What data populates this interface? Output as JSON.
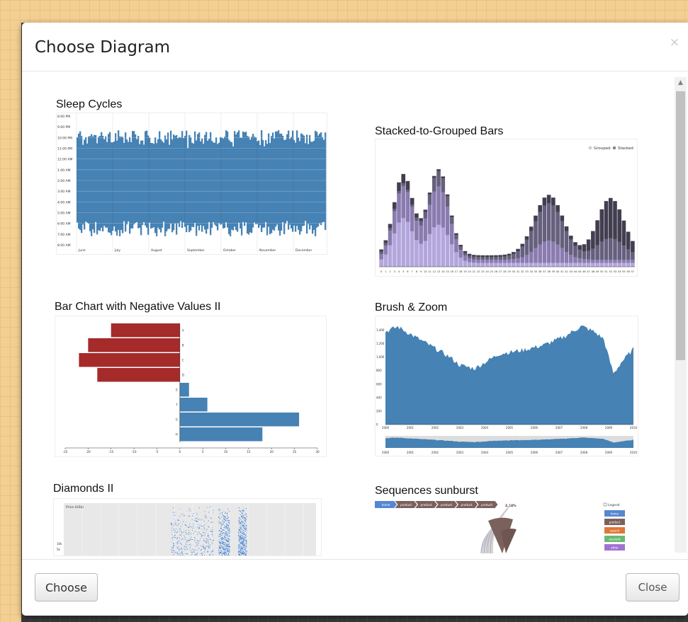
{
  "dialog": {
    "title": "Choose Diagram",
    "close_glyph": "×"
  },
  "diagrams": [
    {
      "title": "Sleep Cycles",
      "y_ticks": [
        "8:00 PM",
        "9:00 PM",
        "10:00 PM",
        "11:00 PM",
        "12:00 AM",
        "1:00 AM",
        "2:00 AM",
        "3:00 AM",
        "4:00 AM",
        "5:00 AM",
        "6:00 AM",
        "7:00 AM",
        "8:00 AM"
      ],
      "x_ticks": [
        "June",
        "July",
        "August",
        "September",
        "October",
        "November",
        "December"
      ],
      "color": "#4682b4"
    },
    {
      "title": "Stacked-to-Grouped Bars",
      "legend": [
        "Grouped",
        "Stacked"
      ],
      "x_ticks": [
        "0",
        "1",
        "2",
        "3",
        "4",
        "5",
        "6",
        "7",
        "8",
        "9",
        "10",
        "11",
        "12",
        "13",
        "14",
        "15",
        "16",
        "17",
        "18",
        "19",
        "20",
        "21",
        "22",
        "23",
        "24",
        "25",
        "26",
        "27",
        "28",
        "29",
        "30",
        "31",
        "32",
        "33",
        "34",
        "35",
        "36",
        "37",
        "38",
        "39",
        "40",
        "41",
        "42",
        "43",
        "44",
        "45",
        "46",
        "47",
        "48",
        "49",
        "50",
        "51",
        "52",
        "53",
        "54",
        "55",
        "56",
        "57"
      ]
    },
    {
      "title": "Bar Chart with Negative Values II",
      "categories": [
        "A",
        "B",
        "C",
        "D",
        "E",
        "F",
        "G",
        "H"
      ],
      "values": [
        -15,
        -20,
        -22,
        -18,
        2,
        6,
        26,
        18
      ],
      "x_ticks": [
        "-25",
        "-20",
        "-15",
        "-10",
        "-5",
        "0",
        "5",
        "10",
        "15",
        "20",
        "25",
        "30"
      ],
      "neg_color": "#a52a2a",
      "pos_color": "#4682b4"
    },
    {
      "title": "Brush & Zoom",
      "y_ticks": [
        "1,400",
        "1,200",
        "1,000",
        "800",
        "600",
        "400",
        "200",
        "0"
      ],
      "x_ticks": [
        "2000",
        "2001",
        "2002",
        "2003",
        "2004",
        "2005",
        "2006",
        "2007",
        "2008",
        "2009",
        "2010"
      ],
      "color": "#4682b4"
    },
    {
      "title": "Diamonds II",
      "label": "Price (US$)",
      "y_ticks": [
        "10k",
        "5k"
      ]
    },
    {
      "title": "Sequences sunburst",
      "breadcrumbs": [
        "home",
        "product",
        "product",
        "product",
        "product",
        "product"
      ],
      "percentage": "2.14%",
      "legend_toggle": "Legend",
      "legend": [
        {
          "label": "home",
          "color": "#5687d1"
        },
        {
          "label": "product",
          "color": "#7b615c"
        },
        {
          "label": "search",
          "color": "#de783b"
        },
        {
          "label": "account",
          "color": "#6ab975"
        },
        {
          "label": "other",
          "color": "#a173d1"
        }
      ]
    }
  ],
  "footer": {
    "choose_label": "Choose",
    "close_label": "Close"
  }
}
